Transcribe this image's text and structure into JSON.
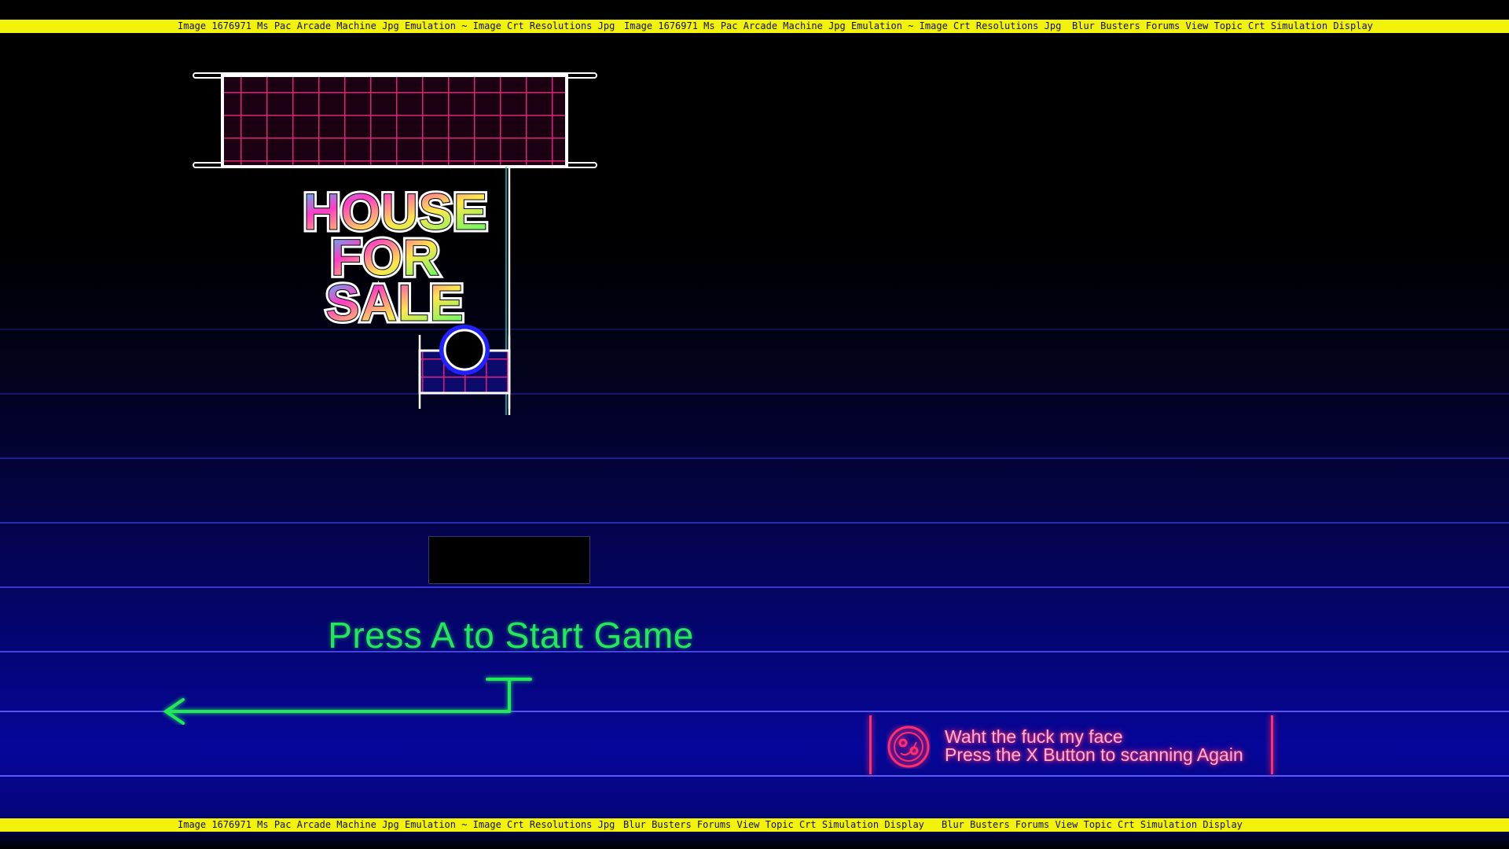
{
  "ticker_top": [
    "Image 1676971 Ms Pac Arcade Machine Jpg Emulation ~ Image Crt Resolutions Jpg",
    "Image 1676971 Ms Pac Arcade Machine Jpg Emulation ~ Image Crt Resolutions Jpg",
    "Blur Busters Forums View Topic Crt Simulation Display"
  ],
  "ticker_bottom": [
    "Image 1676971 Ms Pac Arcade Machine Jpg Emulation ~ Image Crt Resolutions Jpg",
    "Blur Busters Forums View Topic Crt Simulation Display",
    "Blur Busters Forums View Topic Crt Simulation Display"
  ],
  "sign": {
    "lines": [
      "HOUSE",
      "FOR",
      "SALE"
    ],
    "icon": "house-for-sale-sign"
  },
  "game": {
    "start_prompt": "Press A to Start Game",
    "arrow_icon": "left-arrow-icon"
  },
  "notice": {
    "icon": "face-scan-icon",
    "line1": "Waht the fuck my face",
    "line2": "Press the X Button to scanning Again"
  },
  "colors": {
    "ticker_bg": "#f2f20a",
    "prompt_green": "#22e85a",
    "neon_pink": "#ff2e6e",
    "grid_magenta": "#e0207a"
  }
}
